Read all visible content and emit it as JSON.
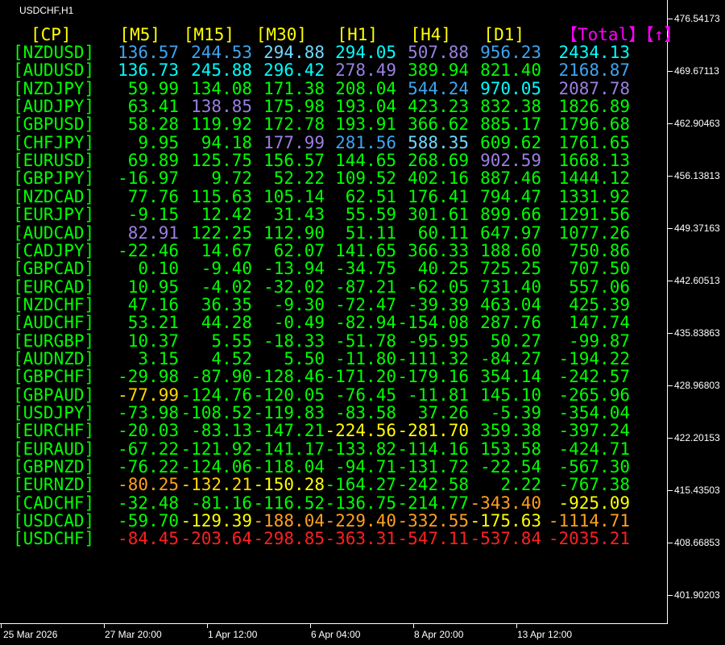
{
  "window": {
    "title": "USDCHF,H1"
  },
  "colors": {
    "header": "#ffff00",
    "pair": "#00ff00",
    "total_header": "#ff00ff",
    "value_default": "#00ff00",
    "value_blue": "#3da5f0",
    "value_skyblue": "#70d8ff",
    "value_cyan": "#00ffff",
    "value_purple": "#9a80e0",
    "value_yellow": "#ffff00",
    "value_gold": "#ffd700",
    "value_orange": "#ffa020",
    "value_red": "#ff2020",
    "axis": "#ffffff"
  },
  "table": {
    "headers": [
      "[CP]",
      "[M5]",
      "[M15]",
      "[M30]",
      "[H1]",
      "[H4]",
      "[D1]",
      "【Total】【↑】"
    ],
    "rows": [
      {
        "pair": "[NZDUSD]",
        "values": [
          "136.57",
          "244.53",
          "294.88",
          "294.05",
          "507.88",
          "956.23",
          "2434.13"
        ],
        "colors": [
          "blue",
          "blue",
          "skyblue",
          "cyan",
          "purple",
          "blue",
          "cyan"
        ]
      },
      {
        "pair": "[AUDUSD]",
        "values": [
          "136.73",
          "245.88",
          "296.42",
          "278.49",
          "389.94",
          "821.40",
          "2168.87"
        ],
        "colors": [
          "cyan",
          "cyan",
          "cyan",
          "purple",
          "default",
          "default",
          "blue"
        ]
      },
      {
        "pair": "[NZDJPY]",
        "values": [
          "59.99",
          "134.08",
          "171.38",
          "208.04",
          "544.24",
          "970.05",
          "2087.78"
        ],
        "colors": [
          "default",
          "default",
          "default",
          "default",
          "blue",
          "cyan",
          "purple"
        ]
      },
      {
        "pair": "[AUDJPY]",
        "values": [
          "63.41",
          "138.85",
          "175.98",
          "193.04",
          "423.23",
          "832.38",
          "1826.89"
        ],
        "colors": [
          "default",
          "purple",
          "default",
          "default",
          "default",
          "default",
          "default"
        ]
      },
      {
        "pair": "[GBPUSD]",
        "values": [
          "58.28",
          "119.92",
          "172.78",
          "193.91",
          "366.62",
          "885.17",
          "1796.68"
        ],
        "colors": [
          "default",
          "default",
          "default",
          "default",
          "default",
          "default",
          "default"
        ]
      },
      {
        "pair": "[CHFJPY]",
        "values": [
          "9.95",
          "94.18",
          "177.99",
          "281.56",
          "588.35",
          "609.62",
          "1761.65"
        ],
        "colors": [
          "default",
          "default",
          "purple",
          "blue",
          "skyblue",
          "default",
          "default"
        ]
      },
      {
        "pair": "[EURUSD]",
        "values": [
          "69.89",
          "125.75",
          "156.57",
          "144.65",
          "268.69",
          "902.59",
          "1668.13"
        ],
        "colors": [
          "default",
          "default",
          "default",
          "default",
          "default",
          "purple",
          "default"
        ]
      },
      {
        "pair": "[GBPJPY]",
        "values": [
          "-16.97",
          "9.72",
          "52.22",
          "109.52",
          "402.16",
          "887.46",
          "1444.12"
        ],
        "colors": [
          "default",
          "default",
          "default",
          "default",
          "default",
          "default",
          "default"
        ]
      },
      {
        "pair": "[NZDCAD]",
        "values": [
          "77.76",
          "115.63",
          "105.14",
          "62.51",
          "176.41",
          "794.47",
          "1331.92"
        ],
        "colors": [
          "default",
          "default",
          "default",
          "default",
          "default",
          "default",
          "default"
        ]
      },
      {
        "pair": "[EURJPY]",
        "values": [
          "-9.15",
          "12.42",
          "31.43",
          "55.59",
          "301.61",
          "899.66",
          "1291.56"
        ],
        "colors": [
          "default",
          "default",
          "default",
          "default",
          "default",
          "default",
          "default"
        ]
      },
      {
        "pair": "[AUDCAD]",
        "values": [
          "82.91",
          "122.25",
          "112.90",
          "51.11",
          "60.11",
          "647.97",
          "1077.26"
        ],
        "colors": [
          "purple",
          "default",
          "default",
          "default",
          "default",
          "default",
          "default"
        ]
      },
      {
        "pair": "[CADJPY]",
        "values": [
          "-22.46",
          "14.67",
          "62.07",
          "141.65",
          "366.33",
          "188.60",
          "750.86"
        ],
        "colors": [
          "default",
          "default",
          "default",
          "default",
          "default",
          "default",
          "default"
        ]
      },
      {
        "pair": "[GBPCAD]",
        "values": [
          "0.10",
          "-9.40",
          "-13.94",
          "-34.75",
          "40.25",
          "725.25",
          "707.50"
        ],
        "colors": [
          "default",
          "default",
          "default",
          "default",
          "default",
          "default",
          "default"
        ]
      },
      {
        "pair": "[EURCAD]",
        "values": [
          "10.95",
          "-4.02",
          "-32.02",
          "-87.21",
          "-62.05",
          "731.40",
          "557.06"
        ],
        "colors": [
          "default",
          "default",
          "default",
          "default",
          "default",
          "default",
          "default"
        ]
      },
      {
        "pair": "[NZDCHF]",
        "values": [
          "47.16",
          "36.35",
          "-9.30",
          "-72.47",
          "-39.39",
          "463.04",
          "425.39"
        ],
        "colors": [
          "default",
          "default",
          "default",
          "default",
          "default",
          "default",
          "default"
        ]
      },
      {
        "pair": "[AUDCHF]",
        "values": [
          "53.21",
          "44.28",
          "-0.49",
          "-82.94",
          "-154.08",
          "287.76",
          "147.74"
        ],
        "colors": [
          "default",
          "default",
          "default",
          "default",
          "default",
          "default",
          "default"
        ]
      },
      {
        "pair": "[EURGBP]",
        "values": [
          "10.37",
          "5.55",
          "-18.33",
          "-51.78",
          "-95.95",
          "50.27",
          "-99.87"
        ],
        "colors": [
          "default",
          "default",
          "default",
          "default",
          "default",
          "default",
          "default"
        ]
      },
      {
        "pair": "[AUDNZD]",
        "values": [
          "3.15",
          "4.52",
          "5.50",
          "-11.80",
          "-111.32",
          "-84.27",
          "-194.22"
        ],
        "colors": [
          "default",
          "default",
          "default",
          "default",
          "default",
          "default",
          "default"
        ]
      },
      {
        "pair": "[GBPCHF]",
        "values": [
          "-29.98",
          "-87.90",
          "-128.46",
          "-171.20",
          "-179.16",
          "354.14",
          "-242.57"
        ],
        "colors": [
          "default",
          "default",
          "default",
          "default",
          "default",
          "default",
          "default"
        ]
      },
      {
        "pair": "[GBPAUD]",
        "values": [
          "-77.99",
          "-124.76",
          "-120.05",
          "-76.45",
          "-11.81",
          "145.10",
          "-265.96"
        ],
        "colors": [
          "gold",
          "default",
          "default",
          "default",
          "default",
          "default",
          "default"
        ]
      },
      {
        "pair": "[USDJPY]",
        "values": [
          "-73.98",
          "-108.52",
          "-119.83",
          "-83.58",
          "37.26",
          "-5.39",
          "-354.04"
        ],
        "colors": [
          "default",
          "default",
          "default",
          "default",
          "default",
          "default",
          "default"
        ]
      },
      {
        "pair": "[EURCHF]",
        "values": [
          "-20.03",
          "-83.13",
          "-147.21",
          "-224.56",
          "-281.70",
          "359.38",
          "-397.24"
        ],
        "colors": [
          "default",
          "default",
          "default",
          "yellow",
          "yellow",
          "default",
          "default"
        ]
      },
      {
        "pair": "[EURAUD]",
        "values": [
          "-67.22",
          "-121.92",
          "-141.17",
          "-133.82",
          "-114.16",
          "153.58",
          "-424.71"
        ],
        "colors": [
          "default",
          "default",
          "default",
          "default",
          "default",
          "default",
          "default"
        ]
      },
      {
        "pair": "[GBPNZD]",
        "values": [
          "-76.22",
          "-124.06",
          "-118.04",
          "-94.71",
          "-131.72",
          "-22.54",
          "-567.30"
        ],
        "colors": [
          "default",
          "default",
          "default",
          "default",
          "default",
          "default",
          "default"
        ]
      },
      {
        "pair": "[EURNZD]",
        "values": [
          "-80.25",
          "-132.21",
          "-150.28",
          "-164.27",
          "-242.58",
          "2.22",
          "-767.38"
        ],
        "colors": [
          "orange",
          "gold",
          "yellow",
          "default",
          "default",
          "default",
          "default"
        ]
      },
      {
        "pair": "[CADCHF]",
        "values": [
          "-32.48",
          "-81.16",
          "-116.52",
          "-136.75",
          "-214.77",
          "-343.40",
          "-925.09"
        ],
        "colors": [
          "default",
          "default",
          "default",
          "default",
          "default",
          "orange",
          "yellow"
        ]
      },
      {
        "pair": "[USDCAD]",
        "values": [
          "-59.70",
          "-129.39",
          "-188.04",
          "-229.40",
          "-332.55",
          "-175.63",
          "-1114.71"
        ],
        "colors": [
          "default",
          "yellow",
          "orange",
          "orange",
          "orange",
          "yellow",
          "orange"
        ]
      },
      {
        "pair": "[USDCHF]",
        "values": [
          "-84.45",
          "-203.64",
          "-298.85",
          "-363.31",
          "-547.11",
          "-537.84",
          "-2035.21"
        ],
        "colors": [
          "red",
          "red",
          "red",
          "red",
          "red",
          "red",
          "red"
        ]
      }
    ]
  },
  "price_axis": {
    "labels": [
      "476.54173",
      "469.67113",
      "462.90463",
      "456.13813",
      "449.37163",
      "442.60513",
      "435.83863",
      "428.96803",
      "422.20153",
      "415.43503",
      "408.66853",
      "401.90203"
    ]
  },
  "time_axis": {
    "labels": [
      "25 Mar 2026",
      "27 Mar 20:00",
      "1 Apr 12:00",
      "6 Apr 04:00",
      "8 Apr 20:00",
      "13 Apr 12:00"
    ]
  }
}
